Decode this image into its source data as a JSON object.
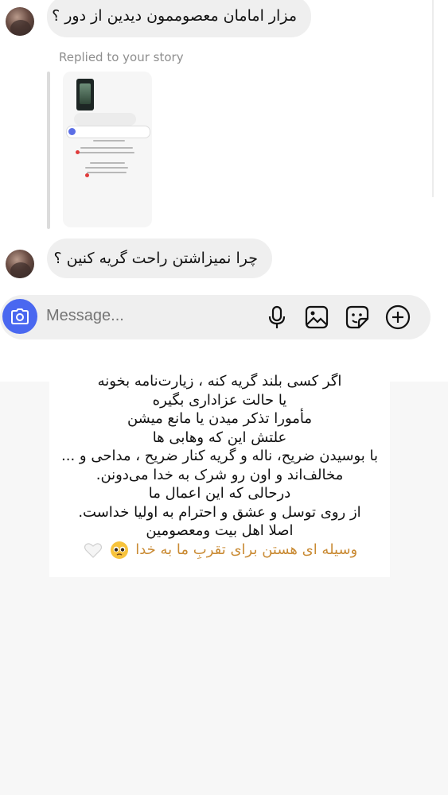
{
  "messages": [
    {
      "text": "مزار امامان معصوممون دیدین از دور ؟"
    },
    {
      "text": "چرا نمیزاشتن راحت گریه کنین ؟"
    }
  ],
  "replied_label": "Replied to your story",
  "composer": {
    "placeholder": "Message..."
  },
  "caption": {
    "lines": [
      "اگر کسی بلند گریه کنه ، زیارت‌نامه بخونه",
      "یا حالت عزاداری بگیره",
      "مأمورا  تذکر میدن یا مانع  میشن",
      "علتش این  که  وهابی ها",
      "با بوسیدن ضریح، ناله و گریه کنار ضریح ، مداحی و ...",
      "مخالف‌اند و اون رو شرک  به خدا می‌دونن.",
      "درحالی که  این اعمال ما",
      "از روی توسل و عشق و احترام  به اولیا خداست.",
      "اصلا اهل بیت  ومعصومین"
    ],
    "last_line": "وسیله ای  هستن برای تقربِ ما به خدا"
  },
  "colors": {
    "camera_button": "#4a68f0",
    "bubble": "#efefef",
    "caption_highlight": "#c98a33"
  },
  "icons": [
    "camera-icon",
    "microphone-icon",
    "gallery-icon",
    "sticker-icon",
    "add-icon",
    "pleading-face-emoji",
    "white-heart-emoji"
  ]
}
